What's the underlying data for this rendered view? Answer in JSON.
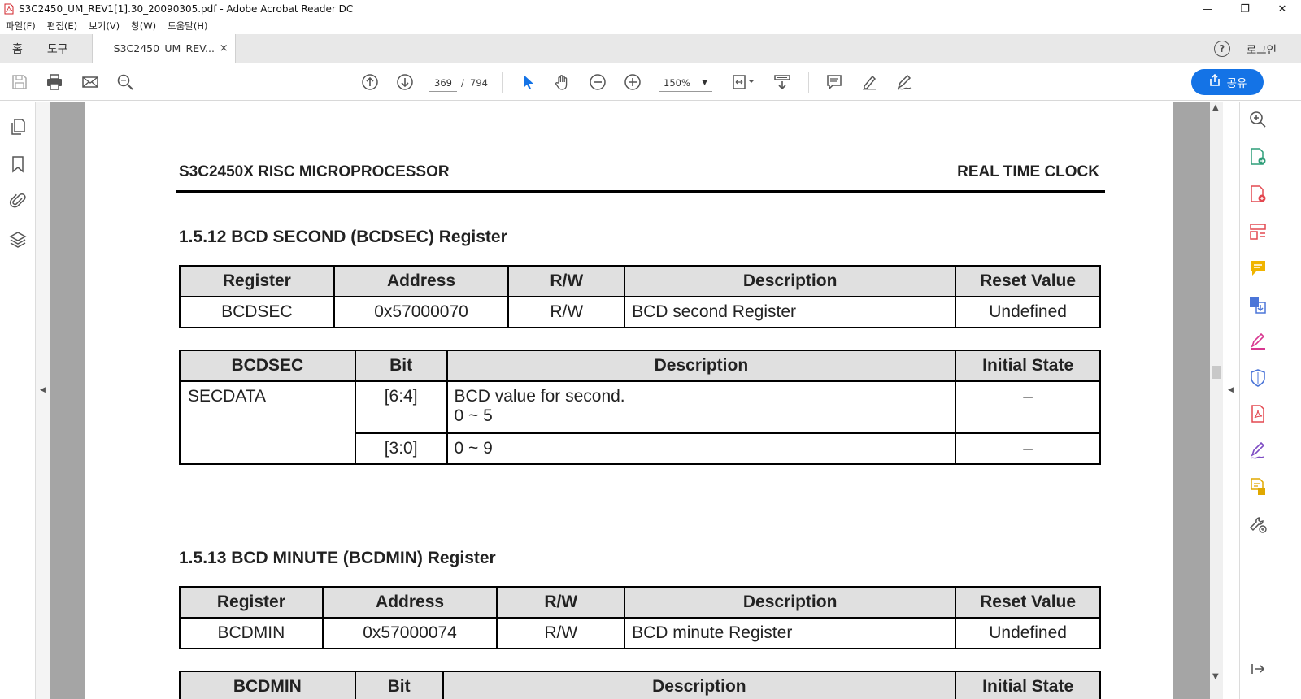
{
  "window": {
    "title": "S3C2450_UM_REV1[1].30_20090305.pdf - Adobe Acrobat Reader DC",
    "minimize": "—",
    "maximize": "❐",
    "close": "✕"
  },
  "menu": [
    "파일(F)",
    "편집(E)",
    "보기(V)",
    "창(W)",
    "도움말(H)"
  ],
  "tabs": {
    "home": "홈",
    "tools": "도구",
    "document": "S3C2450_UM_REV...",
    "close": "×",
    "help": "?",
    "login": "로그인"
  },
  "toolbar": {
    "page_current": "369",
    "page_separator": "/",
    "page_total": "794",
    "zoom": "150%",
    "share_label": "공유",
    "icons": [
      "save-icon",
      "print-icon",
      "email-icon",
      "search-icon",
      "prev-page-icon",
      "next-page-icon",
      "select-cursor-icon",
      "hand-icon",
      "zoom-out-icon",
      "zoom-in-icon",
      "page-fit-icon",
      "scroll-mode-icon",
      "comment-icon",
      "highlight-icon",
      "sign-icon"
    ]
  },
  "document": {
    "header_left": "S3C2450X RISC MICROPROCESSOR",
    "header_right": "REAL TIME CLOCK",
    "section1": {
      "title": "1.5.12 BCD SECOND (BCDSEC) Register",
      "reg_table": {
        "headers": [
          "Register",
          "Address",
          "R/W",
          "Description",
          "Reset Value"
        ],
        "row": [
          "BCDSEC",
          "0x57000070",
          "R/W",
          "BCD second Register",
          "Undefined"
        ]
      },
      "bit_table": {
        "headers": [
          "BCDSEC",
          "Bit",
          "Description",
          "Initial State"
        ],
        "field": "SECDATA",
        "rows": [
          {
            "bit": "[6:4]",
            "desc_line1": "BCD value for second.",
            "desc_line2": "0 ~ 5",
            "init": "–"
          },
          {
            "bit": "[3:0]",
            "desc_line1": "0 ~ 9",
            "init": "–"
          }
        ]
      }
    },
    "section2": {
      "title": "1.5.13 BCD MINUTE (BCDMIN) Register",
      "reg_table": {
        "headers": [
          "Register",
          "Address",
          "R/W",
          "Description",
          "Reset Value"
        ],
        "row": [
          "BCDMIN",
          "0x57000074",
          "R/W",
          "BCD minute Register",
          "Undefined"
        ]
      },
      "bit_table": {
        "headers": [
          "BCDMIN",
          "Bit",
          "Description",
          "Initial State"
        ]
      }
    }
  },
  "colors": {
    "accent": "#1473e6",
    "page_bg": "#a5a5a5",
    "table_header": "#e0e0e0"
  }
}
